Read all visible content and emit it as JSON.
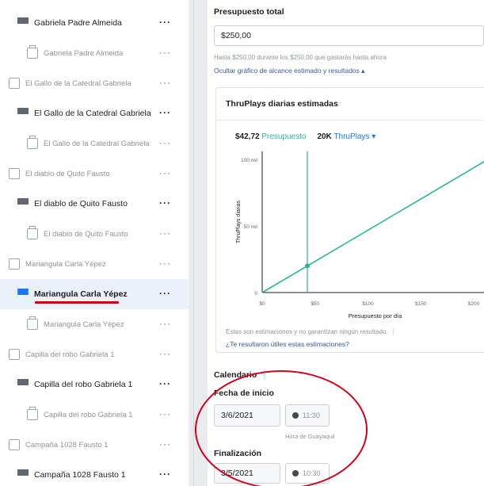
{
  "tree": {
    "items": [
      {
        "kind": "adset",
        "level": 1,
        "label": "Gabriela Padre Almeida",
        "menu": "···"
      },
      {
        "kind": "ad",
        "level": 2,
        "label": "Gabriela Padre Almeida",
        "menu": "···"
      },
      {
        "kind": "campaign",
        "level": 0,
        "label": "El Gallo de la Catedral Gabriela",
        "menu": "···"
      },
      {
        "kind": "adset",
        "level": 1,
        "label": "El Gallo de la Catedral Gabriela",
        "menu": "···"
      },
      {
        "kind": "ad",
        "level": 2,
        "label": "El Gallo de la Catedral Gabriela",
        "menu": "···"
      },
      {
        "kind": "campaign",
        "level": 0,
        "label": "El diablo de Quito Fausto",
        "menu": "···"
      },
      {
        "kind": "adset",
        "level": 1,
        "label": "El diablo de Quito Fausto",
        "menu": "···"
      },
      {
        "kind": "ad",
        "level": 2,
        "label": "El diablo de Quito Fausto",
        "menu": "···"
      },
      {
        "kind": "campaign",
        "level": 0,
        "label": "Mariangula Carla Yépez",
        "menu": "···"
      },
      {
        "kind": "adset",
        "level": 1,
        "label": "Mariangula Carla Yépez",
        "menu": "···",
        "selected": true
      },
      {
        "kind": "ad",
        "level": 2,
        "label": "Mariangula Carla Yépez",
        "menu": "···"
      },
      {
        "kind": "campaign",
        "level": 0,
        "label": "Capilla del robo Gabriela 1",
        "menu": "···"
      },
      {
        "kind": "adset",
        "level": 1,
        "label": "Capilla del robo Gabriela 1",
        "menu": "···"
      },
      {
        "kind": "ad",
        "level": 2,
        "label": "Capilla del robo Gabriela 1",
        "menu": "···"
      },
      {
        "kind": "campaign",
        "level": 0,
        "label": "Campaña 1028 Fausto 1",
        "menu": "···"
      },
      {
        "kind": "adset",
        "level": 1,
        "label": "Campaña 1028 Fausto 1",
        "menu": "···"
      }
    ]
  },
  "budget": {
    "label": "Presupuesto total",
    "value": "$250,00",
    "help": "Hasta $250,00 durante los $250,00 que gastarás hasta ahora",
    "toggle_link": "Ocultar gráfico de alcance estimado y resultados ▴"
  },
  "chart_card": {
    "title": "ThruPlays diarias estimadas",
    "legend_budget_value": "$42,72",
    "legend_budget_label": "Presupuesto",
    "legend_results_value": "20K",
    "legend_results_label": "ThruPlays ▾",
    "note": "Estas son estimaciones y no garantizan ningún resultado.",
    "feedback_link": "¿Te resultaron útiles estas estimaciones?"
  },
  "chart_data": {
    "type": "line",
    "ylabel": "ThruPlays diarias",
    "xlabel": "Presupuesto por día",
    "x_ticks": [
      "$0",
      "$50",
      "$100",
      "$150",
      "$200"
    ],
    "y_ticks": [
      "0",
      "50 mil",
      "100 mil"
    ],
    "xlim": [
      0,
      200
    ],
    "ylim": [
      0,
      100000
    ],
    "series": [
      {
        "x": [
          0,
          42.72,
          220
        ],
        "y": [
          0,
          20000,
          103000
        ]
      }
    ],
    "marker": {
      "x": 42.72,
      "y": 20000
    },
    "colors": {
      "line": "#2bb598",
      "axis": "#1c1e21",
      "grid": "#e4e6eb"
    }
  },
  "schedule": {
    "label": "Calendario",
    "start_label": "Fecha de inicio",
    "start_date": "3/6/2021",
    "start_time": "11:30",
    "timezone_note": "Hora de Guayaquil",
    "end_label": "Finalización",
    "end_date": "3/5/2021",
    "end_time": "10:30"
  },
  "colors": {
    "accent": "#1877f2",
    "annotation": "#d0021b",
    "chart_green": "#2bb598"
  }
}
